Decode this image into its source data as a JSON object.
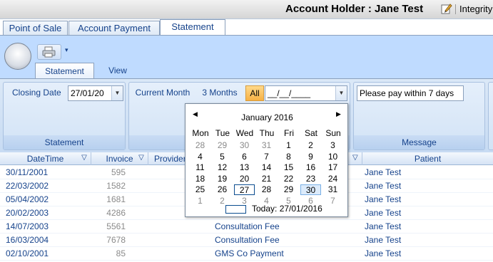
{
  "titlebar": {
    "account_holder": "Account Holder :  Jane Test",
    "app": "Integrity"
  },
  "tabs": [
    "Point of Sale",
    "Account Payment",
    "Statement"
  ],
  "ribbon": {
    "tabs": [
      "Statement",
      "View"
    ],
    "closing_date_label": "Closing Date",
    "closing_date_value": "27/01/20",
    "current_month": "Current Month",
    "three_months": "3 Months",
    "all": "All",
    "date_mask": "__/__/____",
    "message_value": "Please pay within 7 days",
    "groups": [
      "Statement",
      "Message"
    ]
  },
  "grid": {
    "headers": [
      "DateTime",
      "Invoice",
      "Provider",
      "Patient"
    ],
    "rows": [
      {
        "date": "30/11/2001",
        "invoice": "595",
        "desc": "",
        "patient": "Jane Test"
      },
      {
        "date": "22/03/2002",
        "invoice": "1582",
        "desc": "",
        "patient": "Jane Test"
      },
      {
        "date": "05/04/2002",
        "invoice": "1681",
        "desc": "",
        "patient": "Jane Test"
      },
      {
        "date": "20/02/2003",
        "invoice": "4286",
        "desc": "",
        "patient": "Jane Test"
      },
      {
        "date": "14/07/2003",
        "invoice": "5561",
        "desc": "Consultation Fee",
        "patient": "Jane Test"
      },
      {
        "date": "16/03/2004",
        "invoice": "7678",
        "desc": "Consultation Fee",
        "patient": "Jane Test"
      },
      {
        "date": "02/10/2001",
        "invoice": "85",
        "desc": "GMS Co Payment",
        "patient": "Jane Test"
      }
    ]
  },
  "calendar": {
    "month": "January 2016",
    "days": [
      "Mon",
      "Tue",
      "Wed",
      "Thu",
      "Fri",
      "Sat",
      "Sun"
    ],
    "weeks": [
      [
        "28",
        "29",
        "30",
        "31",
        "1",
        "2",
        "3"
      ],
      [
        "4",
        "5",
        "6",
        "7",
        "8",
        "9",
        "10"
      ],
      [
        "11",
        "12",
        "13",
        "14",
        "15",
        "16",
        "17"
      ],
      [
        "18",
        "19",
        "20",
        "21",
        "22",
        "23",
        "24"
      ],
      [
        "25",
        "26",
        "27",
        "28",
        "29",
        "30",
        "31"
      ],
      [
        "1",
        "2",
        "3",
        "4",
        "5",
        "6",
        "7"
      ]
    ],
    "today": "Today: 27/01/2016"
  }
}
